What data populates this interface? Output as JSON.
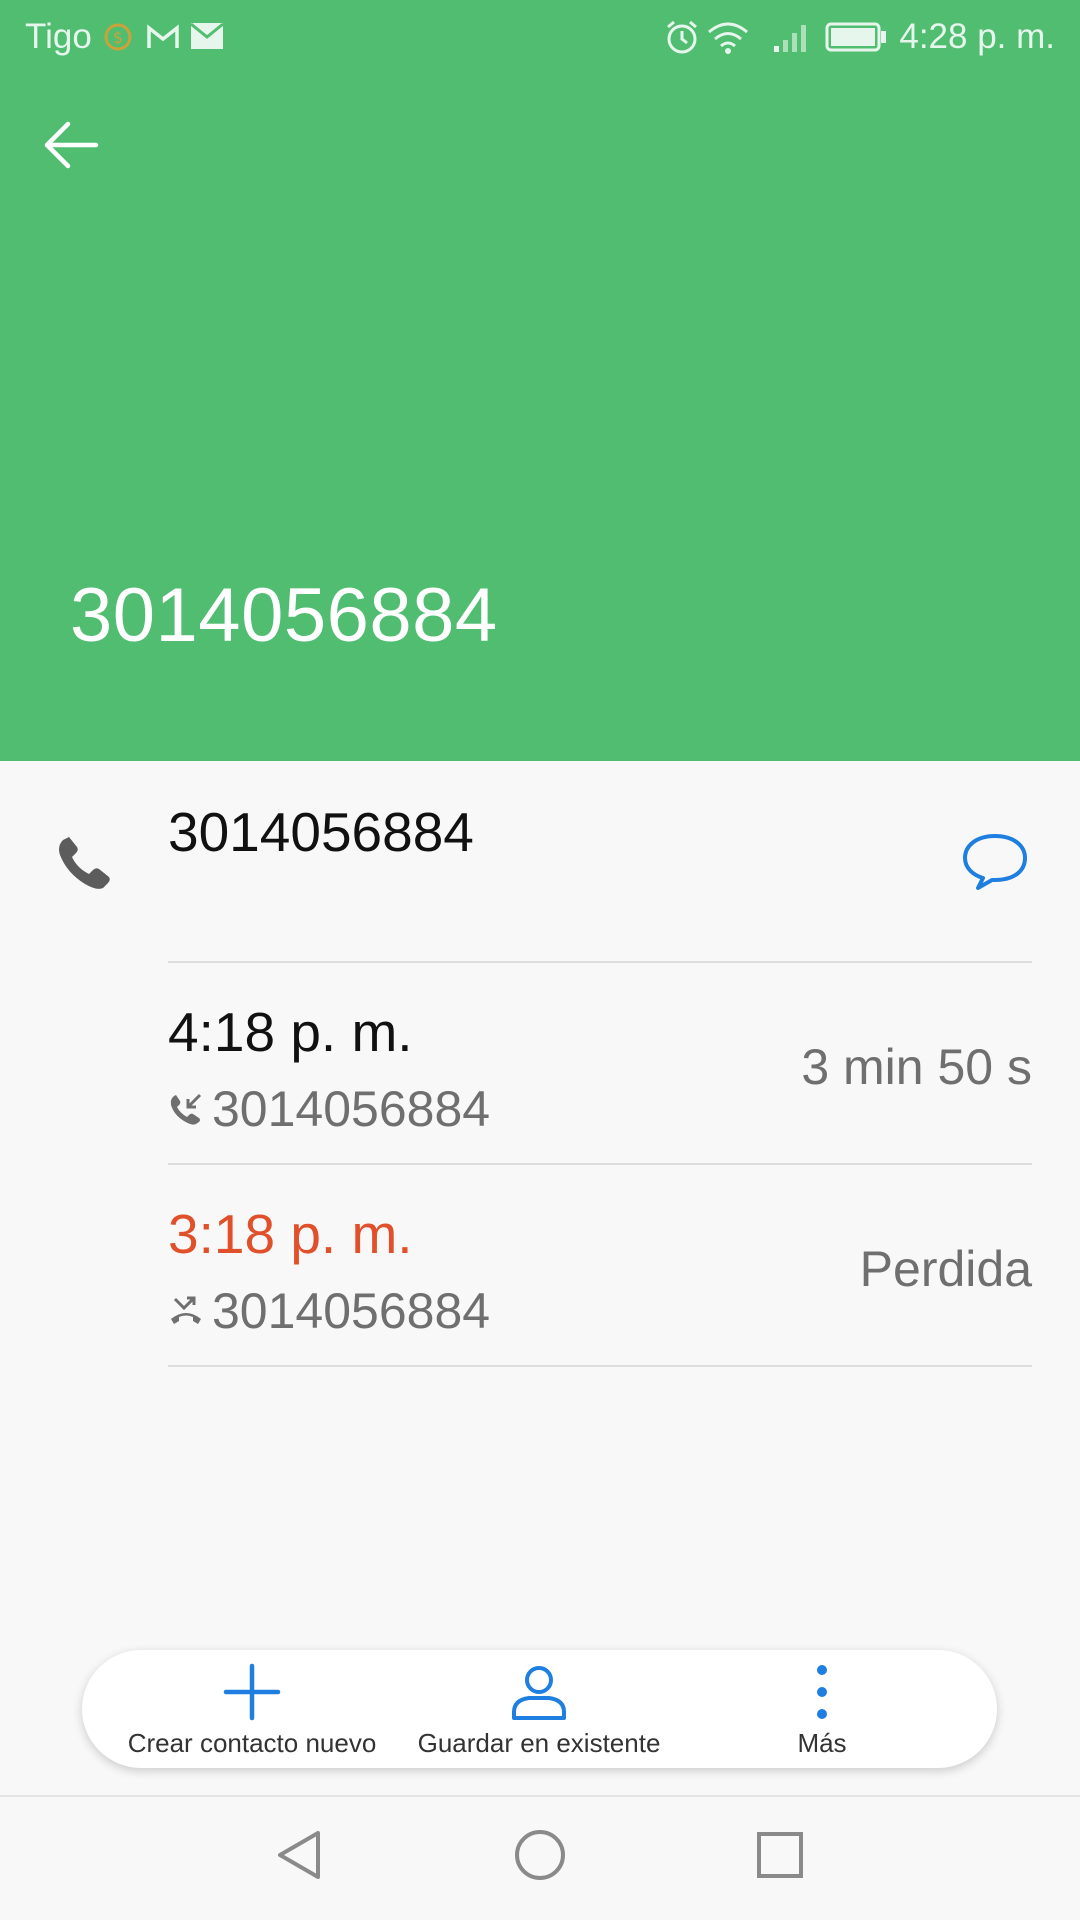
{
  "status_bar": {
    "carrier": "Tigo",
    "time": "4:28 p. m.",
    "icons": [
      "coin-icon",
      "gmail-icon",
      "email-icon",
      "alarm-icon",
      "wifi-icon",
      "signal-icon",
      "battery-icon"
    ]
  },
  "header": {
    "background_color": "#50bd71",
    "title_number": "3014056884"
  },
  "contact_row": {
    "number": "3014056884",
    "left_icon": "phone-icon",
    "message_icon": "message-icon",
    "accent_color": "#1e7fe0"
  },
  "calls": [
    {
      "time": "4:18 p. m.",
      "number": "3014056884",
      "detail": "3 min 50 s",
      "type_icon": "incoming-call-icon",
      "time_color": "#111111"
    },
    {
      "time": "3:18 p. m.",
      "number": "3014056884",
      "detail": "Perdida",
      "type_icon": "missed-call-icon",
      "time_color": "#e0502a"
    }
  ],
  "actions": [
    {
      "label": "Crear contacto nuevo",
      "icon": "plus-icon"
    },
    {
      "label": "Guardar en existente",
      "icon": "person-icon"
    },
    {
      "label": "Más",
      "icon": "more-vertical-icon"
    }
  ],
  "navigation": [
    "back-nav-icon",
    "home-nav-icon",
    "recents-nav-icon"
  ]
}
